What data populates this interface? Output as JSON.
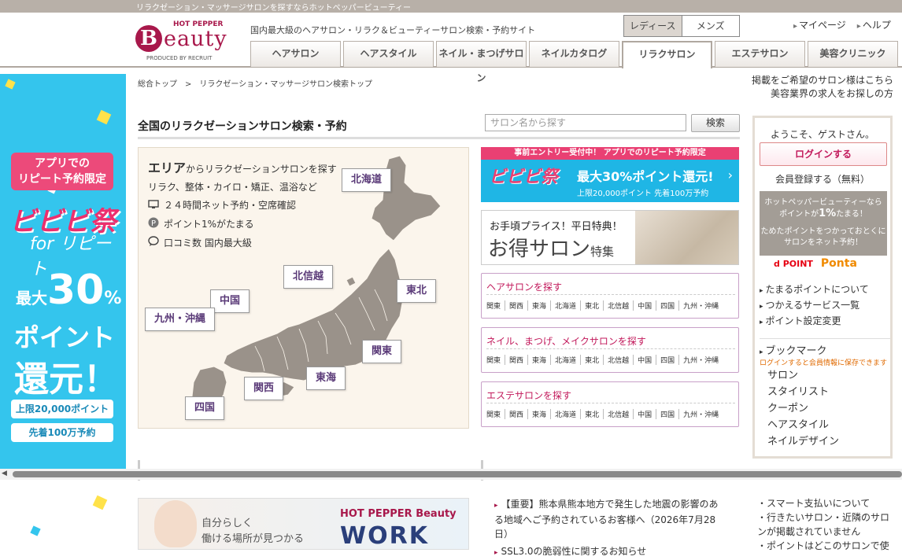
{
  "topbar": {
    "text": "リラクゼーション・マッサージサロンを探すならホットペッパービューティー"
  },
  "logo": {
    "hp": "HOT PEPPER",
    "b": "B",
    "eauty": "eauty",
    "produced": "PRODUCED BY RECRUIT"
  },
  "header": {
    "tagline": "国内最大級のヘアサロン・リラク＆ビューティーサロン検索・予約サイト"
  },
  "gender": {
    "ladies": "レディース",
    "mens": "メンズ"
  },
  "toplinks": {
    "mypage": "マイページ",
    "help": "ヘルプ"
  },
  "nav": {
    "tabs": [
      {
        "label": "ヘアサロン"
      },
      {
        "label": "ヘアスタイル"
      },
      {
        "label": "ネイル・まつげサロン"
      },
      {
        "label": "ネイルカタログ"
      },
      {
        "label": "リラクサロン"
      },
      {
        "label": "エステサロン"
      },
      {
        "label": "美容クリニック"
      }
    ]
  },
  "banner_left": {
    "head1": "アプリでの",
    "head2": "リピート予約限定",
    "fes": "ビビビ祭",
    "for": "for リピート",
    "max": "最大",
    "num": "30",
    "pct": "%",
    "point": "ポイント",
    "kangen": "還元！",
    "limit": "上限20,000ポイント",
    "first": "先着100万予約"
  },
  "breadcrumb": {
    "home": "総合トップ",
    "sep": ">",
    "current": "リラクゼーション・マッサージサロン検索トップ"
  },
  "right_links": {
    "line1": "掲載をご希望のサロン様はこちら",
    "line2": "美容業界の求人をお探しの方"
  },
  "page": {
    "title": "全国のリラクゼーションサロン検索・予約"
  },
  "search": {
    "placeholder": "サロン名から探す",
    "button": "検索"
  },
  "map": {
    "heading_bold": "エリア",
    "heading_rest": "からリラクゼーションサロンを探す",
    "sub": "リラク、整体・カイロ・矯正、温浴など",
    "feat1": "２４時間ネット予約・空席確認",
    "feat2": "ポイント1%がたまる",
    "feat3": "口コミ数 国内最大級",
    "regions": {
      "hokkaido": "北海道",
      "tohoku": "東北",
      "hokushinetsu": "北信越",
      "kanto": "関東",
      "tokai": "東海",
      "kansai": "関西",
      "chugoku": "中国",
      "shikoku": "四国",
      "kyushu": "九州・沖縄"
    }
  },
  "promo1": {
    "top": "事前エントリー受付中！ アプリでのリピート予約限定",
    "fes": "ビビビ祭",
    "max": "最大30%ポイント還元!",
    "limit": "上限20,000ポイント 先着100万予約"
  },
  "promo2": {
    "line1": "お手頃プライス！平日特典！",
    "line2": "お得サロン",
    "line2b": "特集"
  },
  "categories": [
    {
      "title": "ヘアサロンを探す"
    },
    {
      "title": "ネイル、まつげ、メイクサロンを探す"
    },
    {
      "title": "エステサロンを探す"
    }
  ],
  "cat_regions": [
    "関東",
    "関西",
    "東海",
    "北海道",
    "東北",
    "北信越",
    "中国",
    "四国",
    "九州・沖縄"
  ],
  "login": {
    "welcome": "ようこそ、ゲストさん。",
    "login_button": "ログインする",
    "register": "会員登録する（無料）",
    "pt1": "ホットペッパービューティーなら",
    "pt2": "ポイントが",
    "pt_pct": "1%",
    "pt3": "たまる！",
    "pt4": "ためたポイントをつかっておとくに",
    "pt5": "サロンをネット予約！",
    "dpoint": "d POINT",
    "ponta": "Ponta",
    "links": [
      "たまるポイントについて",
      "つかえるサービス一覧",
      "ポイント設定変更"
    ],
    "bookmark": "ブックマーク",
    "bookmark_note": "ログインすると会員情報に保存できます",
    "bookmark_items": [
      "サロン",
      "スタイリスト",
      "クーポン",
      "ヘアスタイル",
      "ネイルデザイン"
    ]
  },
  "work": {
    "line1": "自分らしく",
    "line2": "働ける場所が見つかる",
    "brand": "HOT PEPPER Beauty",
    "work": "WORK"
  },
  "news": {
    "item1": "【重要】熊本県熊本地方で発生した地震の影響のある地域へご予約されているお客様へ（2026年7月28日）",
    "item2": "SSL3.0の脆弱性に関するお知らせ"
  },
  "news2": [
    "スマート支払いについて",
    "行きたいサロン・近隣のサロンが掲載されていません",
    "ポイントはどこのサロンで使"
  ],
  "colors": {
    "brand": "#a8184b",
    "accent_pink": "#c2195b",
    "banner_blue": "#34c5ed",
    "map_gray": "#9a928a"
  }
}
